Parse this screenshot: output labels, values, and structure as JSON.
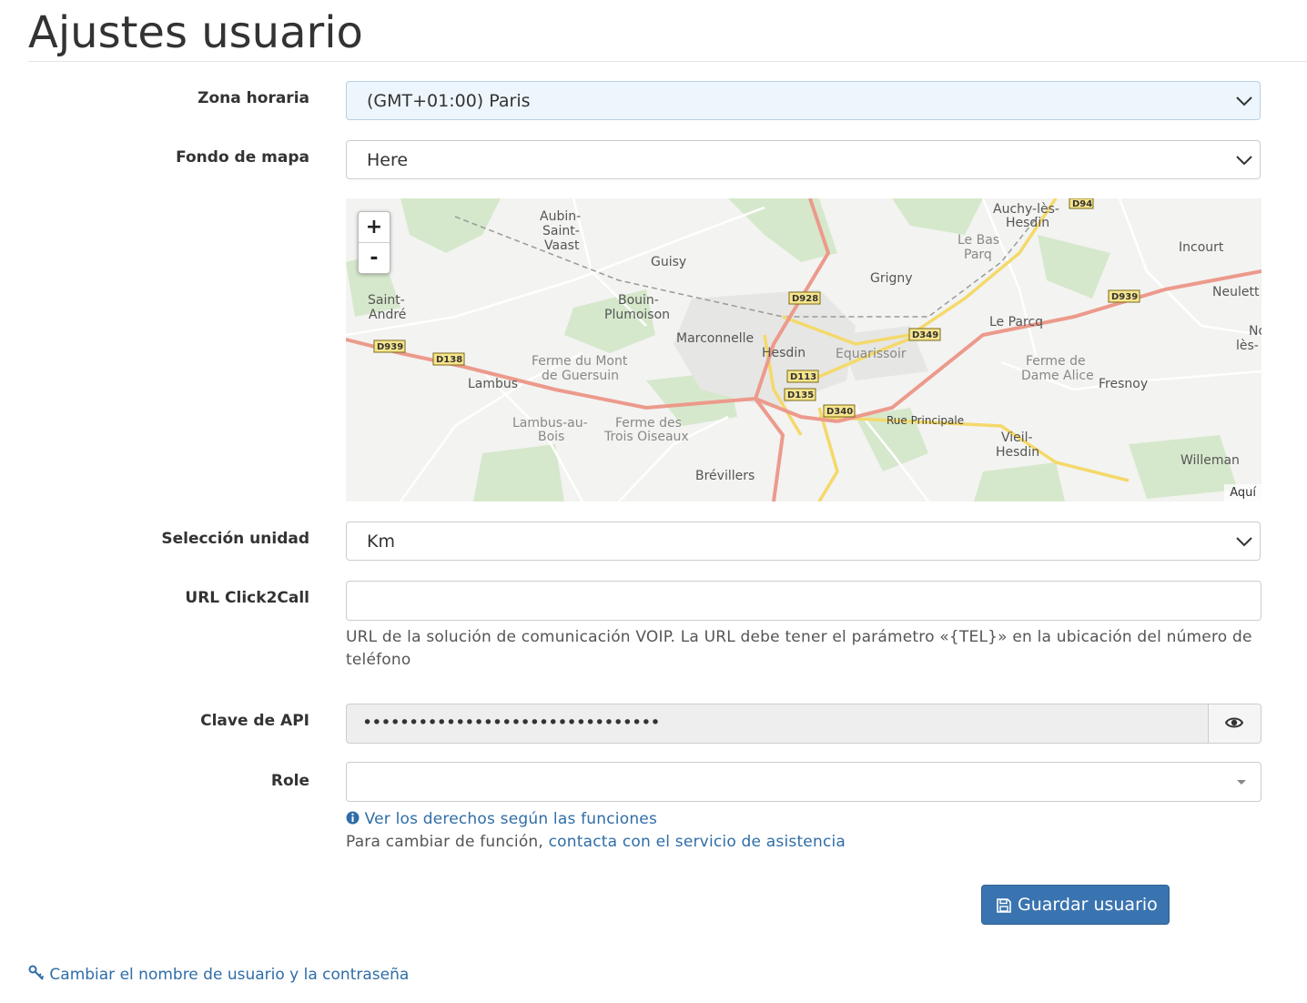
{
  "page": {
    "title": "Ajustes usuario"
  },
  "form": {
    "timezone": {
      "label": "Zona horaria",
      "value": "(GMT+01:00) Paris"
    },
    "map_background": {
      "label": "Fondo de mapa",
      "value": "Here"
    },
    "units": {
      "label": "Selección unidad",
      "value": "Km"
    },
    "click2call": {
      "label": "URL Click2Call",
      "value": "",
      "help": "URL de la solución de comunicación VOIP. La URL debe tener el parámetro «{TEL}» en la ubicación del número de teléfono"
    },
    "api_key": {
      "label": "Clave de API",
      "masked_value": "••••••••••••••••••••••••••••••••"
    },
    "role": {
      "label": "Role",
      "value": "",
      "rights_link": "Ver los derechos según las funciones",
      "change_text": "Para cambiar de función,",
      "support_link": "contacta con el servicio de asistencia"
    },
    "save_button": "Guardar usuario"
  },
  "map": {
    "zoom_in": "+",
    "zoom_out": "-",
    "attribution": "Aquí",
    "place_labels": [
      "Auchy-lès-",
      "Hesdin",
      "Aubin-",
      "Saint-",
      "Vaast",
      "Guisy",
      "Le Bas",
      "Parq",
      "Incourt",
      "Grigny",
      "Neulett",
      "Saint-",
      "André",
      "Bouin-",
      "Plumoison",
      "Le Parcq",
      "No",
      "lès-",
      "Marconnelle",
      "Hesdin",
      "Equarissoir",
      "Ferme du Mont",
      "de Guersuin",
      "Ferme de",
      "Dame Alice",
      "Fresnoy",
      "Lambus",
      "Lambus-au-",
      "Bois",
      "Ferme des",
      "Trois Oiseaux",
      "Rue Principale",
      "Vieil-",
      "Hesdin",
      "Willeman",
      "Brévillers"
    ],
    "road_labels": [
      "D94",
      "D928",
      "D939",
      "D939",
      "D349",
      "D138",
      "D113",
      "D135",
      "D340"
    ]
  },
  "footer": {
    "change_credentials_link": "Cambiar el nombre de usuario y la contraseña"
  },
  "colors": {
    "link": "#2f6da8",
    "button": "#3a74b0",
    "road_main": "#ec9a8c",
    "road_secondary": "#f4d96b",
    "forest": "#cfe3c4"
  }
}
